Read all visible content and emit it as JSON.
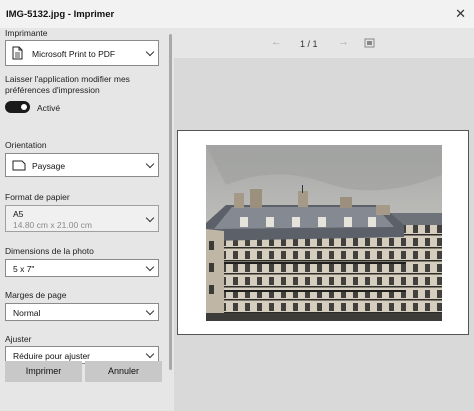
{
  "window": {
    "title": "IMG-5132.jpg - Imprimer"
  },
  "printer": {
    "label": "Imprimante",
    "value": "Microsoft Print to PDF"
  },
  "app_prefs": {
    "label": "Laisser l'application modifier mes préférences d'impression",
    "toggle_state": "Activé"
  },
  "orientation": {
    "label": "Orientation",
    "value": "Paysage"
  },
  "paper_size": {
    "label": "Format de papier",
    "value": "A5",
    "detail": "14.80 cm x 21.00 cm"
  },
  "photo_size": {
    "label": "Dimensions de la photo",
    "value": "5 x 7\""
  },
  "margins": {
    "label": "Marges de page",
    "value": "Normal"
  },
  "fit": {
    "label": "Ajuster",
    "value": "Réduire pour ajuster"
  },
  "buttons": {
    "print": "Imprimer",
    "cancel": "Annuler"
  },
  "preview": {
    "page_indicator": "1 / 1"
  }
}
